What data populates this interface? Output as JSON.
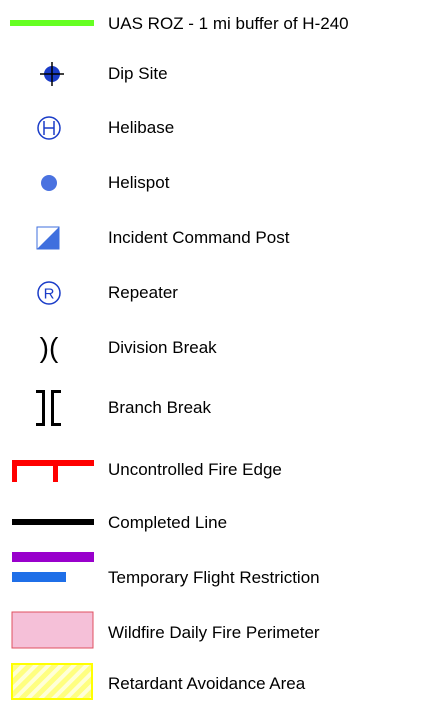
{
  "legend": {
    "items": [
      {
        "label": "UAS ROZ - 1 mi buffer of H-240",
        "icon": "green-line-icon",
        "color": "#66ff22"
      },
      {
        "label": "Dip Site",
        "icon": "crosshair-circle-icon",
        "color": "#1a3cc8"
      },
      {
        "label": "Helibase",
        "icon": "circled-h-icon",
        "color": "#1a3cc8"
      },
      {
        "label": "Helispot",
        "icon": "blue-dot-icon",
        "color": "#4a72e0"
      },
      {
        "label": "Incident Command Post",
        "icon": "half-square-icon",
        "color": "#3f6fde"
      },
      {
        "label": "Repeater",
        "icon": "circled-r-icon",
        "color": "#1a3cc8",
        "glyph": "R"
      },
      {
        "label": "Division Break",
        "icon": "division-break-icon",
        "color": "#000000",
        "glyph": ")("
      },
      {
        "label": "Branch Break",
        "icon": "branch-break-icon",
        "color": "#000000"
      },
      {
        "label": "Uncontrolled Fire Edge",
        "icon": "red-hash-line-icon",
        "color": "#ff0000"
      },
      {
        "label": "Completed Line",
        "icon": "black-line-icon",
        "color": "#000000"
      },
      {
        "label": "Temporary Flight Restriction",
        "icon": "purple-blue-lines-icon",
        "colors": [
          "#9900cc",
          "#1f6fe8"
        ]
      },
      {
        "label": "Wildfire Daily Fire Perimeter",
        "icon": "pink-area-icon",
        "color": "#f5c0d8",
        "border": "#e05060"
      },
      {
        "label": "Retardant Avoidance Area",
        "icon": "yellow-hatched-area-icon",
        "color": "#ffff66"
      }
    ]
  }
}
